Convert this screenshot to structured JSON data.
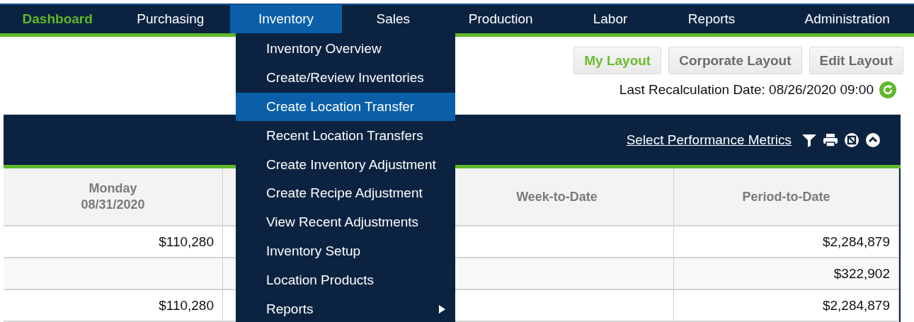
{
  "nav": {
    "items": [
      {
        "label": "Dashboard",
        "current": true,
        "open": false
      },
      {
        "label": "Purchasing",
        "current": false,
        "open": false
      },
      {
        "label": "Inventory",
        "current": false,
        "open": true
      },
      {
        "label": "Sales",
        "current": false,
        "open": false
      },
      {
        "label": "Production",
        "current": false,
        "open": false
      },
      {
        "label": "Labor",
        "current": false,
        "open": false
      },
      {
        "label": "Reports",
        "current": false,
        "open": false
      },
      {
        "label": "Administration",
        "current": false,
        "open": false
      }
    ]
  },
  "menu": {
    "items": [
      {
        "label": "Inventory Overview",
        "selected": false,
        "submenu": false
      },
      {
        "label": "Create/Review Inventories",
        "selected": false,
        "submenu": false
      },
      {
        "label": "Create Location Transfer",
        "selected": true,
        "submenu": false
      },
      {
        "label": "Recent Location Transfers",
        "selected": false,
        "submenu": false
      },
      {
        "label": "Create Inventory Adjustment",
        "selected": false,
        "submenu": false
      },
      {
        "label": "Create Recipe Adjustment",
        "selected": false,
        "submenu": false
      },
      {
        "label": "View Recent Adjustments",
        "selected": false,
        "submenu": false
      },
      {
        "label": "Inventory Setup",
        "selected": false,
        "submenu": false
      },
      {
        "label": "Location Products",
        "selected": false,
        "submenu": false
      },
      {
        "label": "Reports",
        "selected": false,
        "submenu": true
      }
    ]
  },
  "layouts": [
    {
      "label": "My Layout",
      "selected": true
    },
    {
      "label": "Corporate Layout",
      "selected": false
    },
    {
      "label": "Edit Layout",
      "selected": false
    }
  ],
  "recalculation": {
    "label": "Last Recalculation Date: 08/26/2020 09:00"
  },
  "panel": {
    "link": "Select Performance Metrics"
  },
  "table": {
    "columns": [
      {
        "lines": [
          "Monday",
          "08/31/2020"
        ]
      },
      {},
      {
        "lines": [
          "Week-to-Date"
        ]
      },
      {
        "lines": [
          "Period-to-Date"
        ]
      }
    ],
    "rows": [
      {
        "cells": [
          "$110,280",
          null,
          null,
          "$2,284,879"
        ]
      },
      {
        "cells": [
          null,
          null,
          null,
          "$322,902"
        ]
      },
      {
        "cells": [
          "$110,280",
          null,
          null,
          "$2,284,879"
        ]
      }
    ]
  }
}
